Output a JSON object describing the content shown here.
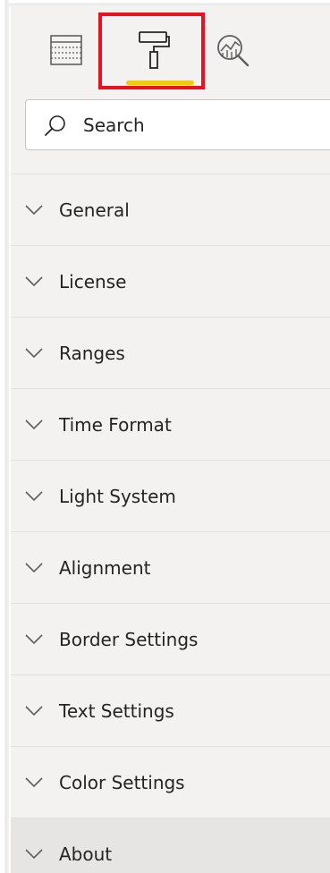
{
  "toolbar": {
    "tabs": [
      {
        "name": "fields",
        "icon": "table-icon",
        "active": false
      },
      {
        "name": "format",
        "icon": "paint-roller-icon",
        "active": true
      },
      {
        "name": "analytics",
        "icon": "magnifier-chart-icon",
        "active": false
      }
    ],
    "highlight_color": "#e81123",
    "active_color": "#f2c811"
  },
  "search": {
    "placeholder": "Search",
    "icon": "search-icon"
  },
  "sections": [
    {
      "label": "General"
    },
    {
      "label": "License"
    },
    {
      "label": "Ranges"
    },
    {
      "label": "Time Format"
    },
    {
      "label": "Light System"
    },
    {
      "label": "Alignment"
    },
    {
      "label": "Border Settings"
    },
    {
      "label": "Text Settings"
    },
    {
      "label": "Color Settings"
    },
    {
      "label": "About"
    }
  ]
}
